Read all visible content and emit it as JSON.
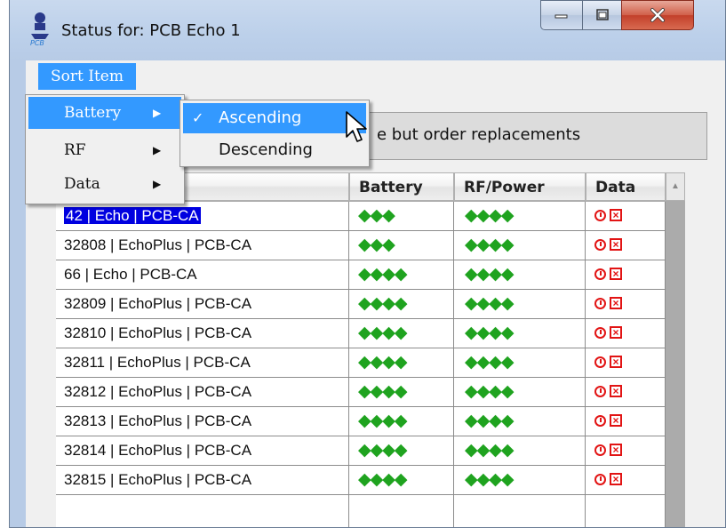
{
  "window": {
    "title": "Status for: PCB Echo 1",
    "caption_buttons": [
      "minimize-icon",
      "maximize-icon",
      "close-icon"
    ]
  },
  "menubar": {
    "sort_item": "Sort Item"
  },
  "sort_menu": {
    "items": [
      {
        "label": "Battery",
        "has_submenu": true,
        "highlighted": true
      },
      {
        "label": "RF",
        "has_submenu": true,
        "highlighted": false
      },
      {
        "label": "Data",
        "has_submenu": true,
        "highlighted": false
      }
    ],
    "submenu": [
      {
        "label": "Ascending",
        "checked": true,
        "highlighted": true
      },
      {
        "label": "Descending",
        "checked": false,
        "highlighted": false
      }
    ],
    "check_glyph": "✓"
  },
  "notice": {
    "text": "e but order replacements"
  },
  "table": {
    "headers": {
      "name": "",
      "battery": "Battery",
      "rf": "RF/Power",
      "data": "Data"
    },
    "rows": [
      {
        "name": "42 | Echo | PCB-CA",
        "battery": "◆◆◆",
        "rf": "◆◆◆◆",
        "selected": true
      },
      {
        "name": "32808 | EchoPlus | PCB-CA",
        "battery": "◆◆◆",
        "rf": "◆◆◆◆",
        "selected": false
      },
      {
        "name": "66 | Echo | PCB-CA",
        "battery": "◆◆◆◆",
        "rf": "◆◆◆◆",
        "selected": false
      },
      {
        "name": "32809 | EchoPlus | PCB-CA",
        "battery": "◆◆◆◆",
        "rf": "◆◆◆◆",
        "selected": false
      },
      {
        "name": "32810 | EchoPlus | PCB-CA",
        "battery": "◆◆◆◆",
        "rf": "◆◆◆◆",
        "selected": false
      },
      {
        "name": "32811 | EchoPlus | PCB-CA",
        "battery": "◆◆◆◆",
        "rf": "◆◆◆◆",
        "selected": false
      },
      {
        "name": "32812 | EchoPlus | PCB-CA",
        "battery": "◆◆◆◆",
        "rf": "◆◆◆◆",
        "selected": false
      },
      {
        "name": "32813 | EchoPlus | PCB-CA",
        "battery": "◆◆◆◆",
        "rf": "◆◆◆◆",
        "selected": false
      },
      {
        "name": "32814 | EchoPlus | PCB-CA",
        "battery": "◆◆◆◆",
        "rf": "◆◆◆◆",
        "selected": false
      },
      {
        "name": "32815 | EchoPlus | PCB-CA",
        "battery": "◆◆◆◆",
        "rf": "◆◆◆◆",
        "selected": false
      }
    ],
    "data_icons": [
      "clock-icon",
      "x-box-icon"
    ],
    "colors": {
      "signal_green": "#1fa31f",
      "alert_red": "#e21414",
      "selection_blue": "#0000e0",
      "menu_highlight": "#3399ff"
    }
  }
}
